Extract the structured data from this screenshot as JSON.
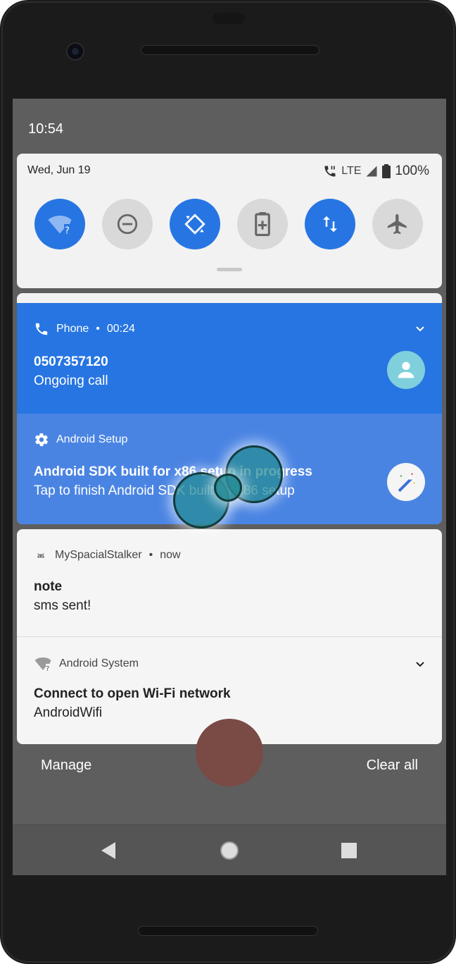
{
  "status_bar": {
    "time": "10:54"
  },
  "quick_settings": {
    "date": "Wed, Jun 19",
    "network": "LTE",
    "battery": "100%",
    "tiles": [
      {
        "name": "wifi",
        "state": "on"
      },
      {
        "name": "do-not-disturb",
        "state": "off"
      },
      {
        "name": "auto-rotate",
        "state": "on"
      },
      {
        "name": "battery-saver",
        "state": "off"
      },
      {
        "name": "mobile-data",
        "state": "on"
      },
      {
        "name": "airplane-mode",
        "state": "off"
      }
    ]
  },
  "notifications": {
    "phone": {
      "app": "Phone",
      "time": "00:24",
      "title": "0507357120",
      "text": "Ongoing call"
    },
    "setup": {
      "app": "Android Setup",
      "title": "Android SDK built for x86 setup in progress",
      "text": "Tap to finish Android SDK built for x86 setup"
    },
    "stalker": {
      "app": "MySpacialStalker",
      "time": "now",
      "title": "note",
      "text": "sms sent!"
    },
    "system": {
      "app": "Android System",
      "title": "Connect to open Wi-Fi network",
      "text": "AndroidWifi"
    }
  },
  "actions": {
    "manage": "Manage",
    "clear_all": "Clear all"
  },
  "colors": {
    "accent_blue": "#2775e2",
    "setup_blue": "#4a84e3",
    "panel": "#f2f2f2"
  }
}
